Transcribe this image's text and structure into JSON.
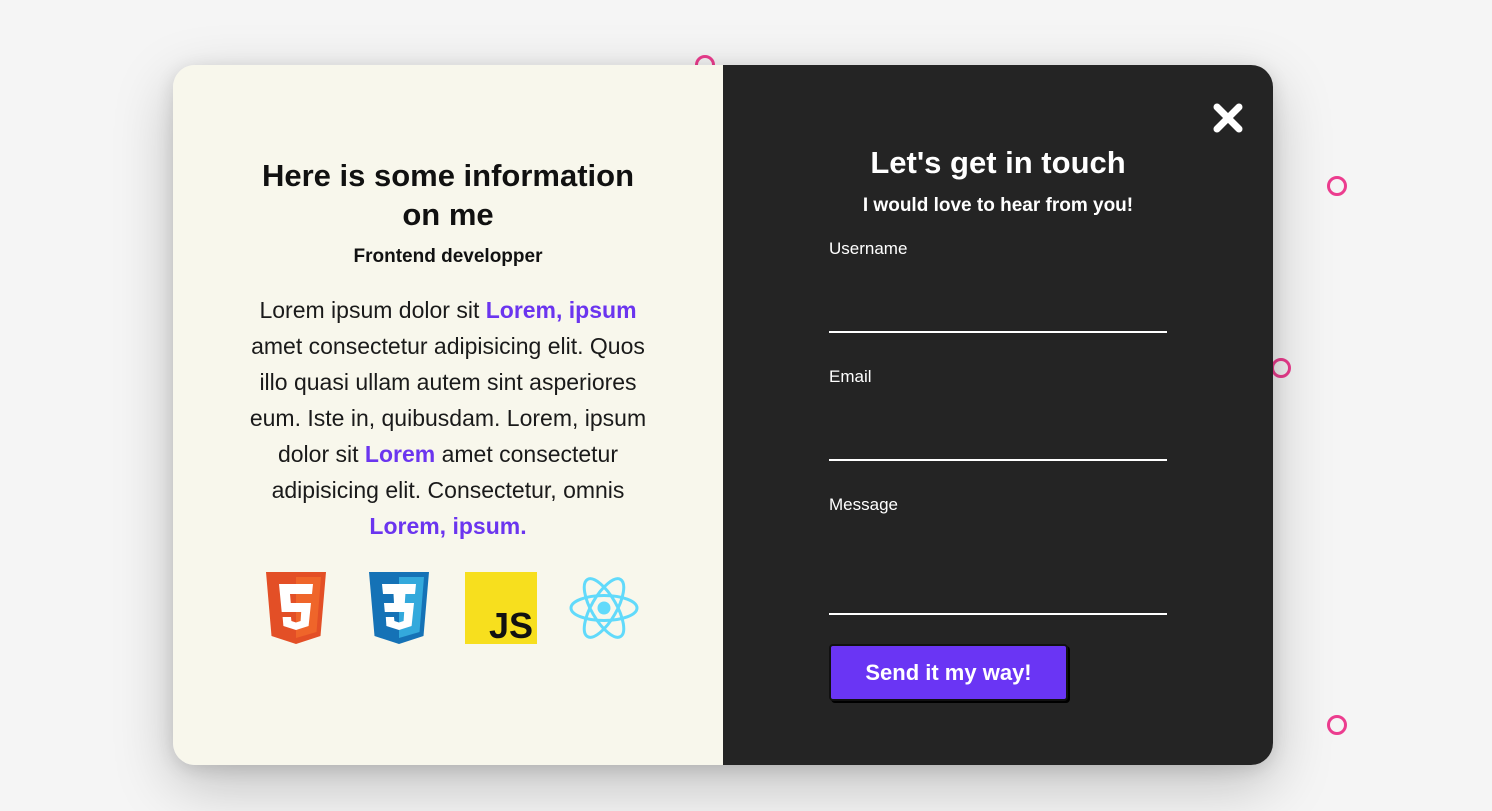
{
  "colors": {
    "accent": "#6b35ef",
    "button": "#6a35f4",
    "left_bg": "#f8f7ec",
    "right_bg": "#242424",
    "decor_ring": "#ec3d8f"
  },
  "info": {
    "title": "Here is some information on me",
    "role": "Frontend developper",
    "bio": [
      {
        "text": "Lorem ipsum dolor sit ",
        "highlight": false
      },
      {
        "text": "Lorem, ipsum",
        "highlight": true
      },
      {
        "text": " amet consectetur adipisicing elit. Quos illo quasi ullam autem sint asperiores eum. Iste in, quibusdam. Lorem, ipsum dolor sit ",
        "highlight": false
      },
      {
        "text": "Lorem",
        "highlight": true
      },
      {
        "text": " amet consectetur adipisicing elit. Consectetur, omnis ",
        "highlight": false
      },
      {
        "text": "Lorem, ipsum.",
        "highlight": true
      }
    ],
    "tech_icons": [
      {
        "name": "html5-icon",
        "label": "5"
      },
      {
        "name": "css3-icon",
        "label": "3"
      },
      {
        "name": "javascript-icon",
        "label": "JS"
      },
      {
        "name": "react-icon",
        "label": ""
      }
    ]
  },
  "contact": {
    "title": "Let's get in touch",
    "subtitle": "I would love to hear from you!",
    "close_icon": "close-icon",
    "fields": {
      "username_label": "Username",
      "username_value": "",
      "email_label": "Email",
      "email_value": "",
      "message_label": "Message",
      "message_value": ""
    },
    "submit_label": "Send it my way!"
  }
}
